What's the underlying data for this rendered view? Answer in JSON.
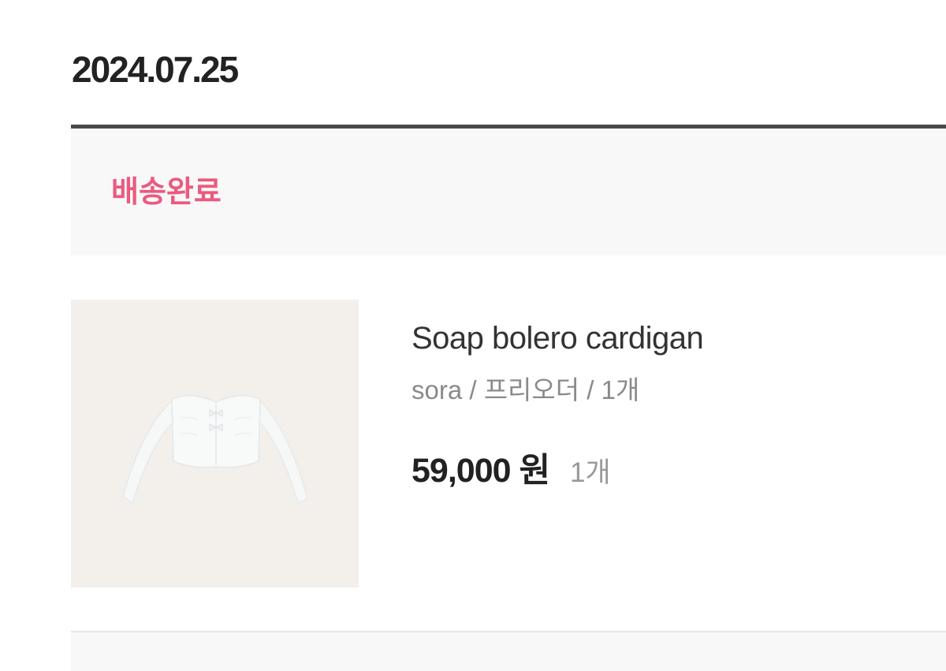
{
  "order": {
    "date": "2024.07.25",
    "status": "배송완료",
    "status_color": "#eb5a7f"
  },
  "item": {
    "image_icon": "cardigan-product-image",
    "name": "Soap bolero cardigan",
    "option": "sora / 프리오더 / 1개",
    "price": "59,000 원",
    "quantity": "1개"
  }
}
